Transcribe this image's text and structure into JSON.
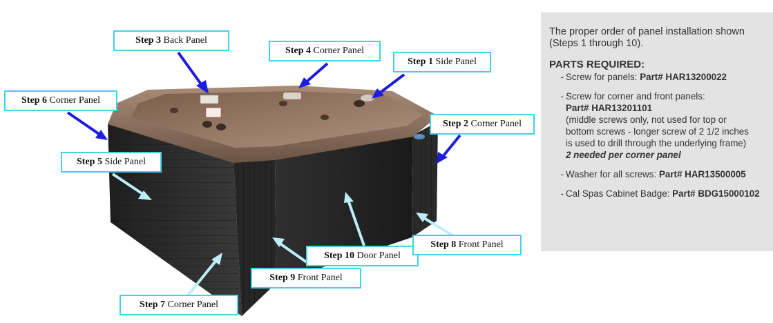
{
  "callouts": [
    {
      "id": "step-3",
      "step": "Step 3",
      "panel": "Back Panel"
    },
    {
      "id": "step-4",
      "step": "Step 4",
      "panel": "Corner Panel"
    },
    {
      "id": "step-1",
      "step": "Step 1",
      "panel": "Side Panel"
    },
    {
      "id": "step-6",
      "step": "Step 6",
      "panel": "Corner Panel"
    },
    {
      "id": "step-2",
      "step": "Step 2",
      "panel": "Corner Panel"
    },
    {
      "id": "step-5",
      "step": "Step 5",
      "panel": "Side Panel"
    },
    {
      "id": "step-10",
      "step": "Step 10",
      "panel": "Door Panel"
    },
    {
      "id": "step-8",
      "step": "Step 8",
      "panel": "Front Panel"
    },
    {
      "id": "step-9",
      "step": "Step 9",
      "panel": "Front Panel"
    },
    {
      "id": "step-7",
      "step": "Step 7",
      "panel": "Corner Panel"
    }
  ],
  "info": {
    "intro": "The proper order of panel installation shown (Steps 1 through 10).",
    "parts_heading": "PARTS REQUIRED:",
    "dash": "-",
    "parts": {
      "screw_panels": {
        "label": "Screw for panels:",
        "part": "Part# HAR13200022"
      },
      "screw_corner": {
        "label": "Screw for corner and front panels:",
        "part": "Part# HAR13201101",
        "note_1": "(middle screws only, not used for top or",
        "note_2": "bottom screws - longer screw of 2 1/2 inches",
        "note_3": "is used to drill through the underlying frame)",
        "qty": "2 needed per corner panel"
      },
      "washer": {
        "label": "Washer for all screws:",
        "part": "Part# HAR13500005"
      },
      "badge": {
        "label": "Cal Spas Cabinet Badge:",
        "part": "Part# BDG15000102"
      }
    }
  },
  "colors": {
    "callout_border": "#3fd3e6",
    "blue_arrow": "#1c1ce0",
    "light_arrow": "#bdeef7",
    "shell": "#8a6f5c",
    "cabinet": "#2b2b2b",
    "info_bg": "#e3e3e3"
  }
}
